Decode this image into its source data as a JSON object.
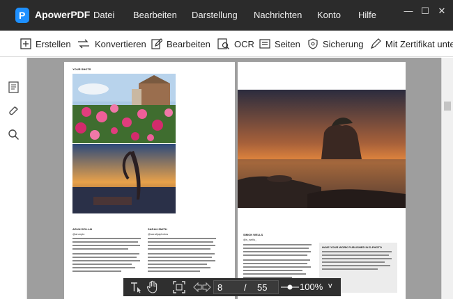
{
  "app": {
    "name": "ApowerPDF",
    "logo_letter": "P"
  },
  "menu": [
    "Datei",
    "Bearbeiten",
    "Darstellung",
    "Nachrichten",
    "Konto",
    "Hilfe"
  ],
  "window_controls": {
    "minimize": "—",
    "maximize": "☐",
    "close": "✕"
  },
  "toolbar": {
    "items": [
      "Erstellen",
      "Konvertieren",
      "Bearbeiten",
      "OCR",
      "Seiten",
      "Sicherung",
      "Mit Zertifikat unte"
    ]
  },
  "sidebar": {
    "icons": [
      "bookmark-icon",
      "attachment-icon",
      "search-icon"
    ]
  },
  "document": {
    "left_page": {
      "header": "YOUR SHOTS",
      "col1_name": "ARUN DPILLAI",
      "col1_handle": "@arunpio",
      "col2_name": "SARAH SMITH",
      "col2_handle": "@sarahjaphotos"
    },
    "right_page": {
      "col1_name": "SIMON WELLS",
      "col1_handle": "@s_wells_",
      "sidebar_title": "HAVE YOUR WORK PUBLISHED IN D-PHOTO"
    }
  },
  "navigation": {
    "current_page": "8",
    "separator": "/",
    "total_pages": "55",
    "zoom": "100%",
    "zoom_dropdown": "v"
  },
  "colors": {
    "titlebar": "#2b2b2b",
    "accent": "#1e90ff",
    "doc_background": "#9e9e9e"
  }
}
